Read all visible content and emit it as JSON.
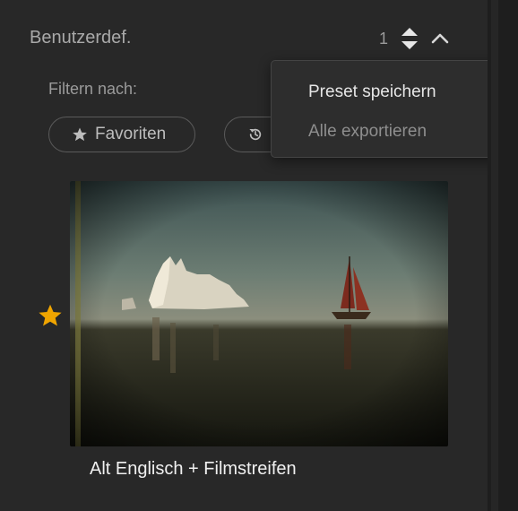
{
  "section": {
    "title": "Benutzerdef.",
    "count": "1"
  },
  "filter": {
    "label": "Filtern nach:",
    "favorites_label": "Favoriten"
  },
  "menu": {
    "save_label": "Preset speichern",
    "export_label": "Alle exportieren"
  },
  "preset": {
    "name": "Alt Englisch + Filmstreifen",
    "favorite": true
  },
  "icons": {
    "sort": "sort-updown-icon",
    "collapse": "chevron-up-icon",
    "favorites": "star-icon",
    "recent": "history-icon",
    "favorite_marker": "star-filled-icon"
  },
  "colors": {
    "star": "#f0a500",
    "menu_bg": "#2d2d2d",
    "panel_bg": "#282828"
  }
}
